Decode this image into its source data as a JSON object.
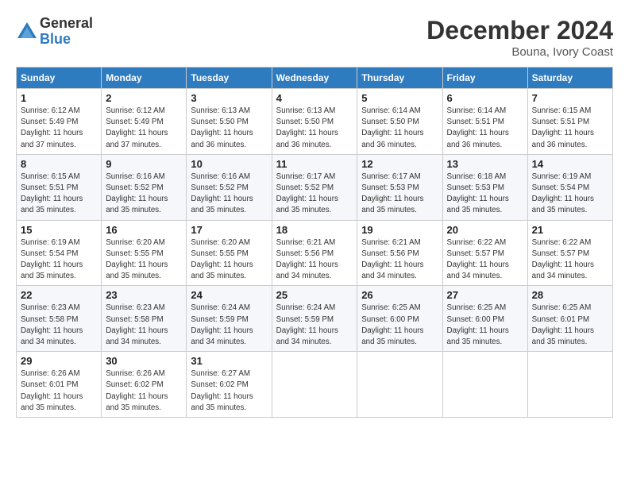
{
  "header": {
    "logo_general": "General",
    "logo_blue": "Blue",
    "month_title": "December 2024",
    "subtitle": "Bouna, Ivory Coast"
  },
  "calendar": {
    "days_of_week": [
      "Sunday",
      "Monday",
      "Tuesday",
      "Wednesday",
      "Thursday",
      "Friday",
      "Saturday"
    ],
    "weeks": [
      [
        {
          "day": "",
          "info": ""
        },
        {
          "day": "",
          "info": ""
        },
        {
          "day": "",
          "info": ""
        },
        {
          "day": "",
          "info": ""
        },
        {
          "day": "",
          "info": ""
        },
        {
          "day": "",
          "info": ""
        },
        {
          "day": "7",
          "info": "Sunrise: 6:15 AM\nSunset: 5:51 PM\nDaylight: 11 hours\nand 36 minutes."
        }
      ],
      [
        {
          "day": "1",
          "info": "Sunrise: 6:12 AM\nSunset: 5:49 PM\nDaylight: 11 hours\nand 37 minutes."
        },
        {
          "day": "2",
          "info": "Sunrise: 6:12 AM\nSunset: 5:49 PM\nDaylight: 11 hours\nand 37 minutes."
        },
        {
          "day": "3",
          "info": "Sunrise: 6:13 AM\nSunset: 5:50 PM\nDaylight: 11 hours\nand 36 minutes."
        },
        {
          "day": "4",
          "info": "Sunrise: 6:13 AM\nSunset: 5:50 PM\nDaylight: 11 hours\nand 36 minutes."
        },
        {
          "day": "5",
          "info": "Sunrise: 6:14 AM\nSunset: 5:50 PM\nDaylight: 11 hours\nand 36 minutes."
        },
        {
          "day": "6",
          "info": "Sunrise: 6:14 AM\nSunset: 5:51 PM\nDaylight: 11 hours\nand 36 minutes."
        },
        {
          "day": "",
          "info": ""
        }
      ],
      [
        {
          "day": "8",
          "info": "Sunrise: 6:15 AM\nSunset: 5:51 PM\nDaylight: 11 hours\nand 35 minutes."
        },
        {
          "day": "9",
          "info": "Sunrise: 6:16 AM\nSunset: 5:52 PM\nDaylight: 11 hours\nand 35 minutes."
        },
        {
          "day": "10",
          "info": "Sunrise: 6:16 AM\nSunset: 5:52 PM\nDaylight: 11 hours\nand 35 minutes."
        },
        {
          "day": "11",
          "info": "Sunrise: 6:17 AM\nSunset: 5:52 PM\nDaylight: 11 hours\nand 35 minutes."
        },
        {
          "day": "12",
          "info": "Sunrise: 6:17 AM\nSunset: 5:53 PM\nDaylight: 11 hours\nand 35 minutes."
        },
        {
          "day": "13",
          "info": "Sunrise: 6:18 AM\nSunset: 5:53 PM\nDaylight: 11 hours\nand 35 minutes."
        },
        {
          "day": "14",
          "info": "Sunrise: 6:19 AM\nSunset: 5:54 PM\nDaylight: 11 hours\nand 35 minutes."
        }
      ],
      [
        {
          "day": "15",
          "info": "Sunrise: 6:19 AM\nSunset: 5:54 PM\nDaylight: 11 hours\nand 35 minutes."
        },
        {
          "day": "16",
          "info": "Sunrise: 6:20 AM\nSunset: 5:55 PM\nDaylight: 11 hours\nand 35 minutes."
        },
        {
          "day": "17",
          "info": "Sunrise: 6:20 AM\nSunset: 5:55 PM\nDaylight: 11 hours\nand 35 minutes."
        },
        {
          "day": "18",
          "info": "Sunrise: 6:21 AM\nSunset: 5:56 PM\nDaylight: 11 hours\nand 34 minutes."
        },
        {
          "day": "19",
          "info": "Sunrise: 6:21 AM\nSunset: 5:56 PM\nDaylight: 11 hours\nand 34 minutes."
        },
        {
          "day": "20",
          "info": "Sunrise: 6:22 AM\nSunset: 5:57 PM\nDaylight: 11 hours\nand 34 minutes."
        },
        {
          "day": "21",
          "info": "Sunrise: 6:22 AM\nSunset: 5:57 PM\nDaylight: 11 hours\nand 34 minutes."
        }
      ],
      [
        {
          "day": "22",
          "info": "Sunrise: 6:23 AM\nSunset: 5:58 PM\nDaylight: 11 hours\nand 34 minutes."
        },
        {
          "day": "23",
          "info": "Sunrise: 6:23 AM\nSunset: 5:58 PM\nDaylight: 11 hours\nand 34 minutes."
        },
        {
          "day": "24",
          "info": "Sunrise: 6:24 AM\nSunset: 5:59 PM\nDaylight: 11 hours\nand 34 minutes."
        },
        {
          "day": "25",
          "info": "Sunrise: 6:24 AM\nSunset: 5:59 PM\nDaylight: 11 hours\nand 34 minutes."
        },
        {
          "day": "26",
          "info": "Sunrise: 6:25 AM\nSunset: 6:00 PM\nDaylight: 11 hours\nand 35 minutes."
        },
        {
          "day": "27",
          "info": "Sunrise: 6:25 AM\nSunset: 6:00 PM\nDaylight: 11 hours\nand 35 minutes."
        },
        {
          "day": "28",
          "info": "Sunrise: 6:25 AM\nSunset: 6:01 PM\nDaylight: 11 hours\nand 35 minutes."
        }
      ],
      [
        {
          "day": "29",
          "info": "Sunrise: 6:26 AM\nSunset: 6:01 PM\nDaylight: 11 hours\nand 35 minutes."
        },
        {
          "day": "30",
          "info": "Sunrise: 6:26 AM\nSunset: 6:02 PM\nDaylight: 11 hours\nand 35 minutes."
        },
        {
          "day": "31",
          "info": "Sunrise: 6:27 AM\nSunset: 6:02 PM\nDaylight: 11 hours\nand 35 minutes."
        },
        {
          "day": "",
          "info": ""
        },
        {
          "day": "",
          "info": ""
        },
        {
          "day": "",
          "info": ""
        },
        {
          "day": "",
          "info": ""
        }
      ]
    ]
  }
}
